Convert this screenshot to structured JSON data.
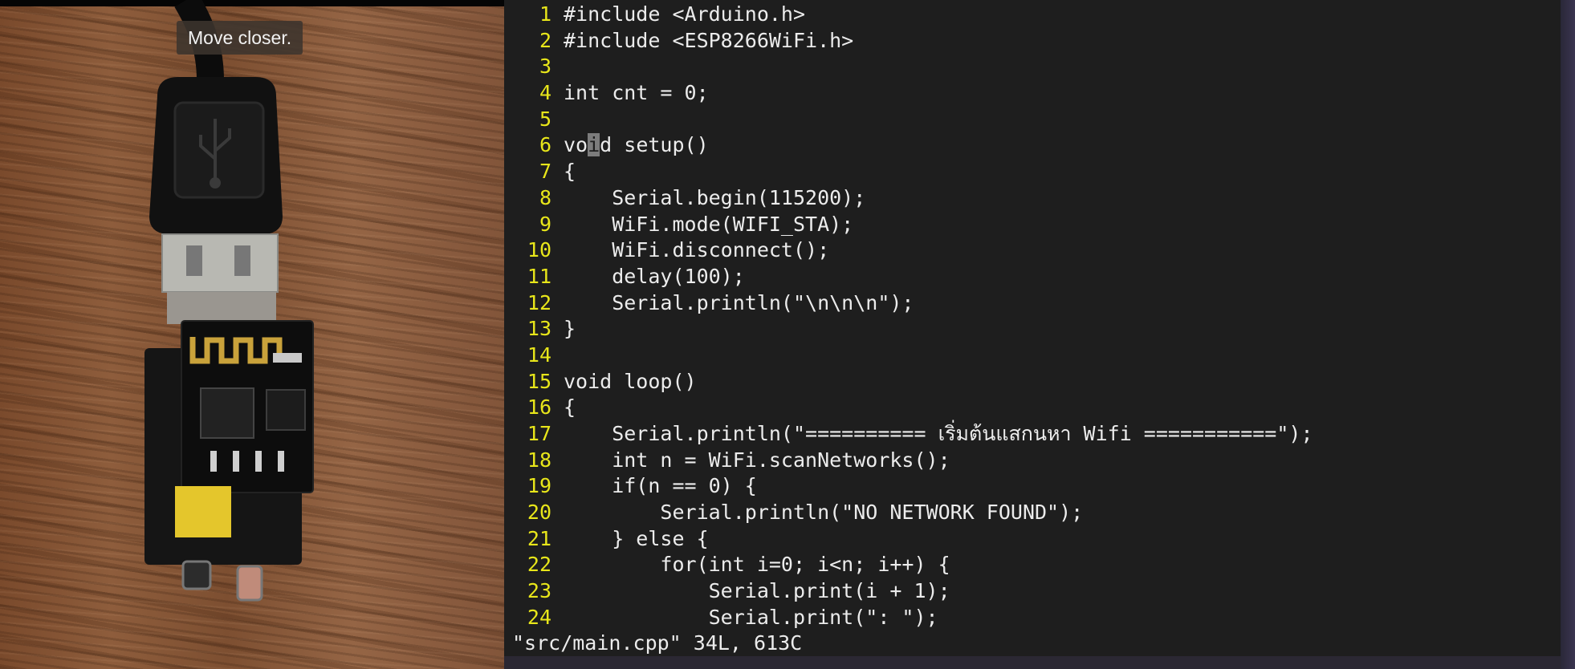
{
  "camera": {
    "hint": "Move closer."
  },
  "editor": {
    "lines": [
      {
        "num": "1",
        "text": "#include <Arduino.h>"
      },
      {
        "num": "2",
        "text": "#include <ESP8266WiFi.h>"
      },
      {
        "num": "3",
        "text": ""
      },
      {
        "num": "4",
        "text": "int cnt = 0;"
      },
      {
        "num": "5",
        "text": ""
      },
      {
        "num": "6",
        "pre": "vo",
        "cur": "i",
        "post": "d setup()"
      },
      {
        "num": "7",
        "text": "{"
      },
      {
        "num": "8",
        "text": "    Serial.begin(115200);"
      },
      {
        "num": "9",
        "text": "    WiFi.mode(WIFI_STA);"
      },
      {
        "num": "10",
        "text": "    WiFi.disconnect();"
      },
      {
        "num": "11",
        "text": "    delay(100);"
      },
      {
        "num": "12",
        "text": "    Serial.println(\"\\n\\n\\n\");"
      },
      {
        "num": "13",
        "text": "}"
      },
      {
        "num": "14",
        "text": ""
      },
      {
        "num": "15",
        "text": "void loop()"
      },
      {
        "num": "16",
        "text": "{"
      },
      {
        "num": "17",
        "text": "    Serial.println(\"========== เริ่มต้นแสกนหา Wifi ===========\");"
      },
      {
        "num": "18",
        "text": "    int n = WiFi.scanNetworks();"
      },
      {
        "num": "19",
        "text": "    if(n == 0) {"
      },
      {
        "num": "20",
        "text": "        Serial.println(\"NO NETWORK FOUND\");"
      },
      {
        "num": "21",
        "text": "    } else {"
      },
      {
        "num": "22",
        "text": "        for(int i=0; i<n; i++) {"
      },
      {
        "num": "23",
        "text": "            Serial.print(i + 1);"
      },
      {
        "num": "24",
        "text": "            Serial.print(\": \");"
      }
    ],
    "status": "\"src/main.cpp\" 34L, 613C"
  },
  "colors": {
    "editor_bg": "#1e1e1e",
    "line_number": "#e8e61a",
    "text": "#ececec",
    "cursor": "#7c7c7c"
  }
}
